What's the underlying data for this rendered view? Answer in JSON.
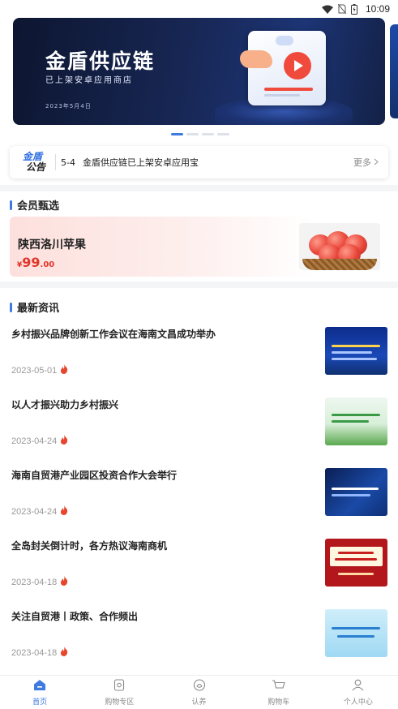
{
  "status_bar": {
    "time": "10:09",
    "icons": [
      "wifi-icon",
      "no-sim-icon",
      "battery-icon"
    ]
  },
  "banner": {
    "title": "金盾供应链",
    "subtitle": "已上架安卓应用商店",
    "date": "2023年5月4日",
    "slide_count": 4,
    "active_slide": 0
  },
  "notice": {
    "logo_line1": "金盾",
    "logo_line2": "公告",
    "date": "5-4",
    "text": "金盾供应链已上架安卓应用宝",
    "more": "更多"
  },
  "member_section": {
    "title": "会员甄选",
    "product": {
      "name": "陕西洛川苹果",
      "currency": "¥",
      "price_int": "99",
      "price_dec": ".00"
    }
  },
  "news_section": {
    "title": "最新资讯",
    "items": [
      {
        "title": "乡村振兴品牌创新工作会议在海南文昌成功举办",
        "date": "2023-05-01",
        "thumb": "thumb-blue"
      },
      {
        "title": "以人才振兴助力乡村振兴",
        "date": "2023-04-24",
        "thumb": "thumb-green"
      },
      {
        "title": "海南自贸港产业园区投资合作大会举行",
        "date": "2023-04-24",
        "thumb": "thumb-navy"
      },
      {
        "title": "全岛封关倒计时，各方热议海南商机",
        "date": "2023-04-18",
        "thumb": "thumb-red"
      },
      {
        "title": "关注自贸港丨政策、合作频出",
        "date": "2023-04-18",
        "thumb": "thumb-light"
      }
    ]
  },
  "tabbar": {
    "tabs": [
      {
        "label": "首页",
        "icon": "home-icon",
        "active": true
      },
      {
        "label": "购物专区",
        "icon": "shopping-bag-icon",
        "active": false
      },
      {
        "label": "认养",
        "icon": "adopt-icon",
        "active": false
      },
      {
        "label": "购物车",
        "icon": "cart-icon",
        "active": false
      },
      {
        "label": "个人中心",
        "icon": "user-icon",
        "active": false
      }
    ]
  },
  "colors": {
    "accent": "#3f7ae0",
    "price": "#e2352a",
    "fire": "#e8452e"
  }
}
